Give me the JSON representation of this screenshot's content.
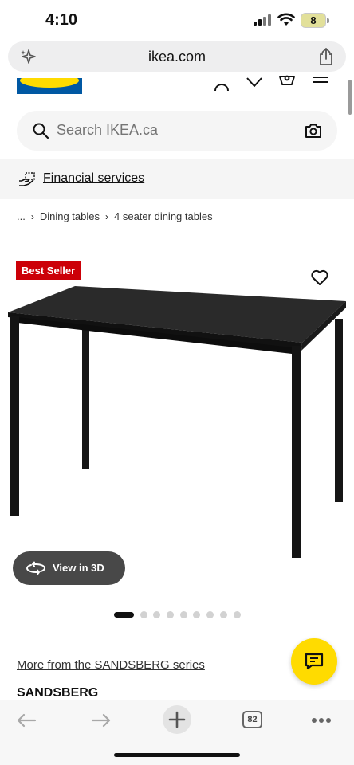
{
  "status_bar": {
    "time": "4:10",
    "battery": "8"
  },
  "browser": {
    "url": "ikea.com",
    "tabs_count": "82"
  },
  "search": {
    "placeholder": "Search IKEA.ca"
  },
  "financial": {
    "label": "Financial services"
  },
  "breadcrumb": {
    "ellipsis": "...",
    "items": [
      "Dining tables",
      "4 seater dining tables"
    ]
  },
  "product": {
    "badge": "Best Seller",
    "view_3d_label": "View in 3D",
    "image_count": 9,
    "active_image": 1,
    "series_link": "More from the SANDSBERG series",
    "name": "SANDSBERG"
  },
  "icons": {
    "sparkle": "sparkle-icon",
    "share": "share-icon",
    "user": "user-icon",
    "heart": "heart-icon",
    "basket": "basket-icon",
    "menu": "menu-icon",
    "search": "search-icon",
    "camera": "camera-icon",
    "chat": "chat-icon"
  },
  "colors": {
    "ikea_blue": "#0058a3",
    "ikea_yellow": "#ffdb00",
    "badge_red": "#cc0008"
  }
}
